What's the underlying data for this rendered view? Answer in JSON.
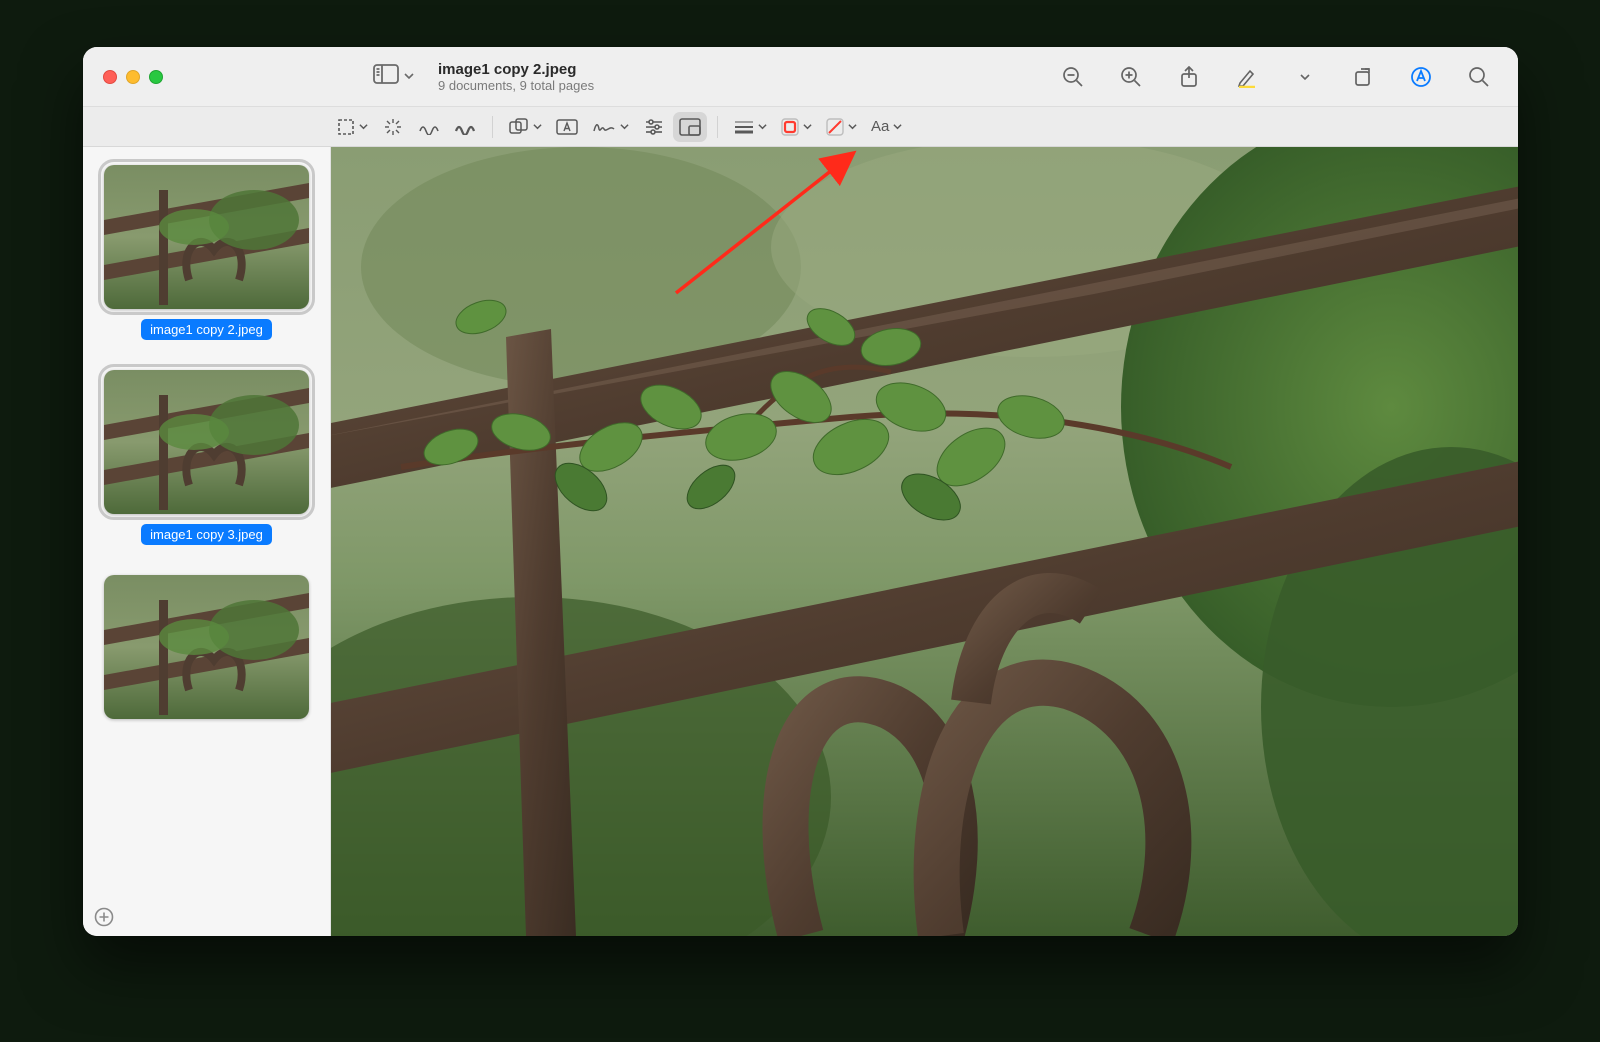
{
  "header": {
    "filename": "image1 copy 2.jpeg",
    "subtitle": "9 documents, 9 total pages"
  },
  "sidebar": {
    "thumbs": [
      {
        "label": "image1 copy 2.jpeg",
        "selected": true
      },
      {
        "label": "image1 copy 3.jpeg",
        "selected": true
      },
      {
        "label": "",
        "selected": false
      }
    ]
  },
  "markup": {
    "text_style_label": "Aa"
  },
  "colors": {
    "accent": "#0a7bff",
    "annotation_red": "#ff3b30"
  }
}
